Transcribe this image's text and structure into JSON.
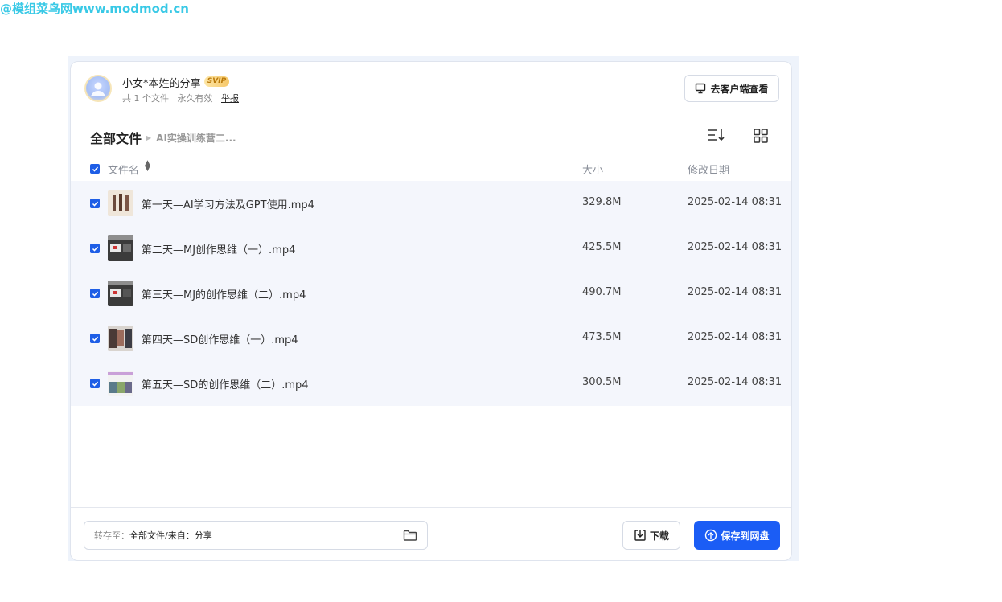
{
  "watermark": "@模组菜鸟网www.modmod.cn",
  "share": {
    "title": "小女*本姓的分享",
    "badge": "SVIP",
    "file_count": "共 1 个文件",
    "validity": "永久有效",
    "report": "举报",
    "client_button": "去客户端查看"
  },
  "breadcrumb": {
    "root": "全部文件",
    "current": "AI实操训练营二..."
  },
  "table": {
    "headers": {
      "name": "文件名",
      "size": "大小",
      "date": "修改日期"
    },
    "rows": [
      {
        "name": "第一天—AI学习方法及GPT使用.mp4",
        "size": "329.8M",
        "date": "2025-02-14 08:31",
        "checked": true
      },
      {
        "name": "第二天—MJ创作思维（一）.mp4",
        "size": "425.5M",
        "date": "2025-02-14 08:31",
        "checked": true
      },
      {
        "name": "第三天—MJ的创作思维（二）.mp4",
        "size": "490.7M",
        "date": "2025-02-14 08:31",
        "checked": true
      },
      {
        "name": "第四天—SD创作思维（一）.mp4",
        "size": "473.5M",
        "date": "2025-02-14 08:31",
        "checked": true
      },
      {
        "name": "第五天—SD的创作思维（二）.mp4",
        "size": "300.5M",
        "date": "2025-02-14 08:31",
        "checked": true
      }
    ]
  },
  "footer": {
    "save_to_label": "转存至：",
    "save_to_path": "全部文件/来自：分享",
    "download_button": "下载",
    "save_button": "保存到网盘"
  },
  "colors": {
    "accent": "#1b5df5",
    "checkbox": "#1e5ee6",
    "row_bg": "#f4f6fc"
  }
}
